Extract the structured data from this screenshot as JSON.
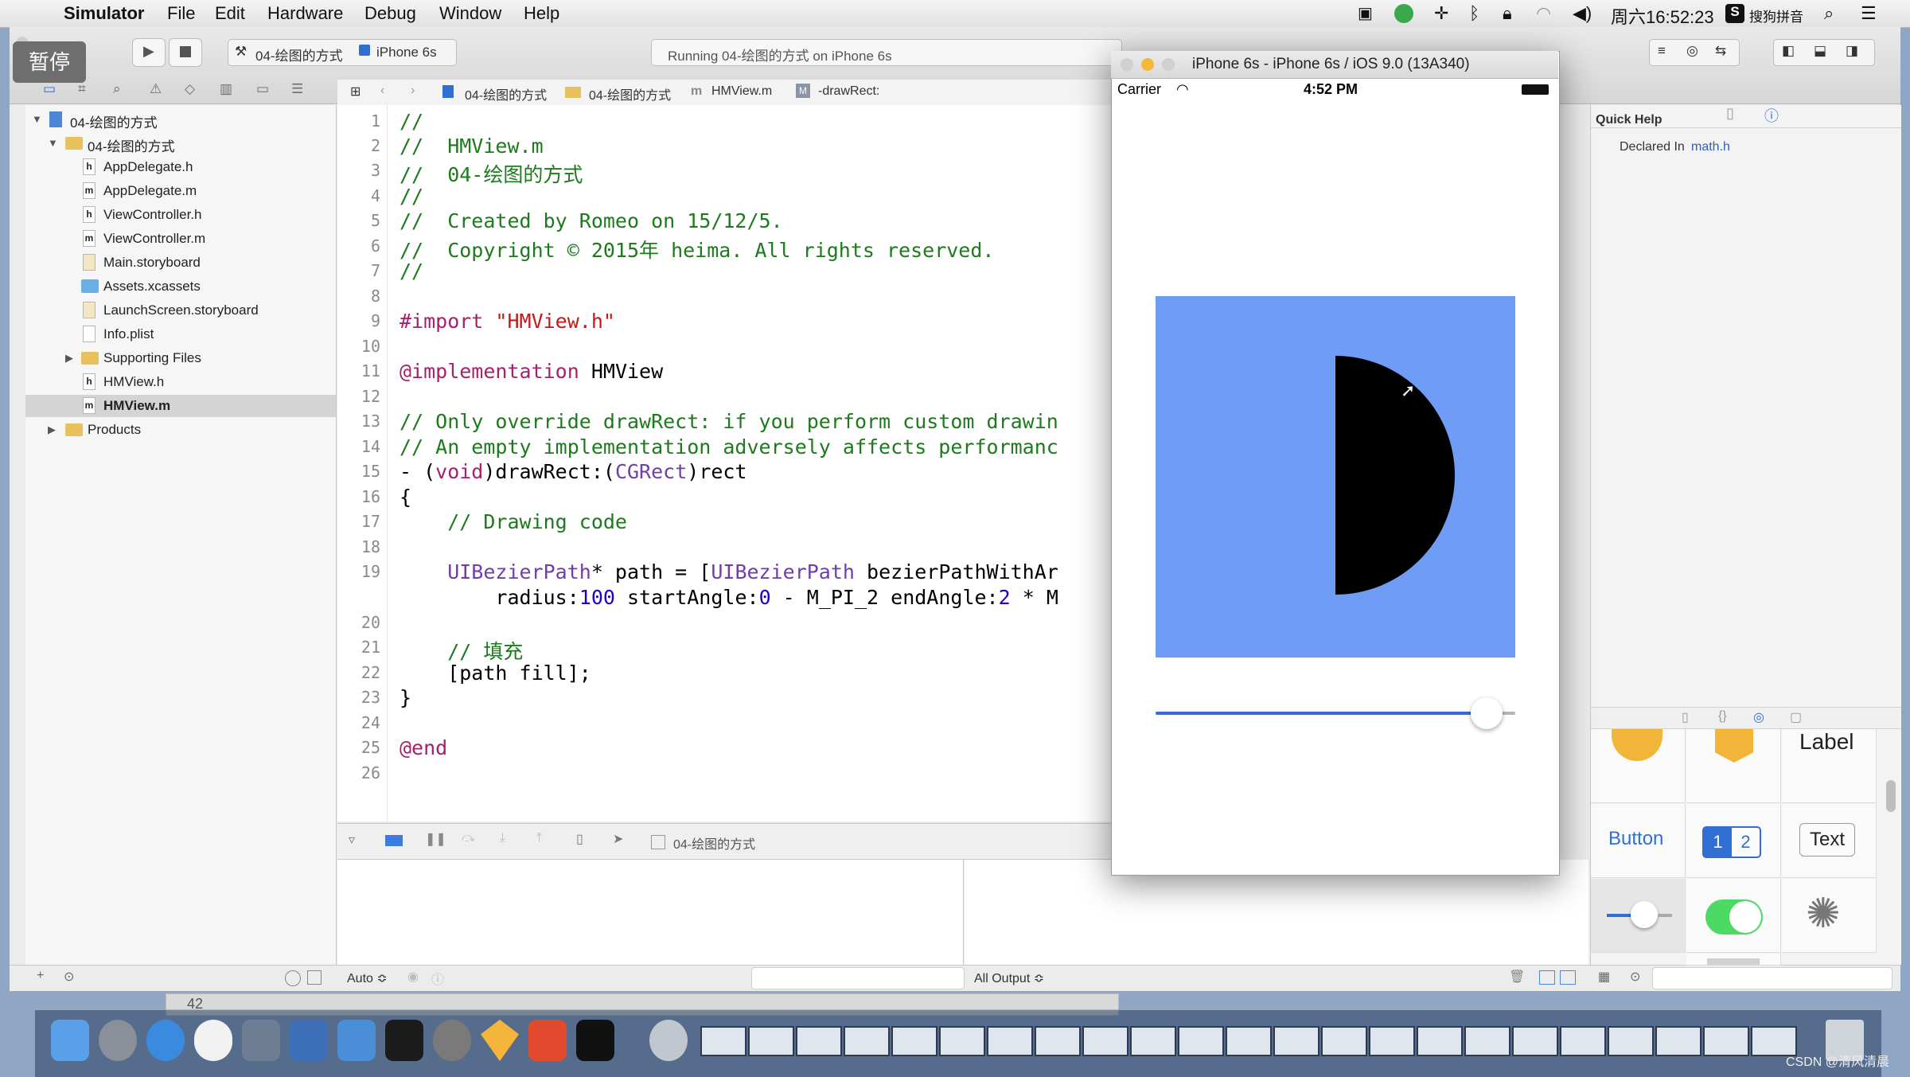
{
  "menubar": {
    "app_name": "Simulator",
    "items": [
      "File",
      "Edit",
      "Hardware",
      "Debug",
      "Window",
      "Help"
    ],
    "clock": "周六16:52:23",
    "input_method": "搜狗拼音"
  },
  "pause_badge": "暂停",
  "toolbar": {
    "scheme": "04-绘图的方式",
    "device": "iPhone 6s",
    "status": "Running 04-绘图的方式 on iPhone 6s"
  },
  "jumpbar": {
    "project": "04-绘图的方式",
    "group": "04-绘图的方式",
    "file": "HMView.m",
    "symbol": "-drawRect:"
  },
  "navigator": {
    "items": [
      {
        "label": "04-绘图的方式",
        "kind": "project"
      },
      {
        "label": "04-绘图的方式",
        "kind": "folder"
      },
      {
        "label": "AppDelegate.h",
        "kind": "h"
      },
      {
        "label": "AppDelegate.m",
        "kind": "m"
      },
      {
        "label": "ViewController.h",
        "kind": "h"
      },
      {
        "label": "ViewController.m",
        "kind": "m"
      },
      {
        "label": "Main.storyboard",
        "kind": "storyboard"
      },
      {
        "label": "Assets.xcassets",
        "kind": "assets"
      },
      {
        "label": "LaunchScreen.storyboard",
        "kind": "storyboard"
      },
      {
        "label": "Info.plist",
        "kind": "plist"
      },
      {
        "label": "Supporting Files",
        "kind": "folder"
      },
      {
        "label": "HMView.h",
        "kind": "h"
      },
      {
        "label": "HMView.m",
        "kind": "m"
      },
      {
        "label": "Products",
        "kind": "folder"
      }
    ]
  },
  "editor": {
    "line_numbers": [
      "1",
      "2",
      "3",
      "4",
      "5",
      "6",
      "7",
      "8",
      "9",
      "10",
      "11",
      "12",
      "13",
      "14",
      "15",
      "16",
      "17",
      "18",
      "19",
      "20",
      "21",
      "22",
      "23",
      "24",
      "25",
      "26"
    ],
    "lines": {
      "l1": "//",
      "l2": "//  HMView.m",
      "l3": "//  04-绘图的方式",
      "l4": "//",
      "l5": "//  Created by Romeo on 15/12/5.",
      "l6": "//  Copyright © 2015年 heima. All rights reserved.",
      "l7": "//",
      "l9_kw": "#import",
      "l9_str": "\"HMView.h\"",
      "l11_kw": "@implementation",
      "l11_rest": "HMView",
      "l13": "// Only override drawRect: if you perform custom drawin",
      "l14": "// An empty implementation adversely affects performanc",
      "l15_a": "- (",
      "l15_kw": "void",
      "l15_b": ")drawRect:(",
      "l15_tp": "CGRect",
      "l15_c": ")rect",
      "l16": "{",
      "l17": "    // Drawing code",
      "l19_tp": "    UIBezierPath",
      "l19_a": "* path = [",
      "l19_tp2": "UIBezierPath",
      "l19_b": " bezierPathWithAr",
      "l20_a": "        radius:",
      "l20_n1": "100",
      "l20_b": " startAngle:",
      "l20_n2": "0",
      "l20_c": " - M_PI_2 endAngle:",
      "l20_n3": "2",
      "l20_d": " * M",
      "l21": "    // 填充",
      "l22": "    [path fill];",
      "l23": "}",
      "l25": "@end"
    }
  },
  "debugbar": {
    "target": "04-绘图的方式"
  },
  "console": {
    "filter_left": "Auto ≎",
    "filter_right": "All Output ≎"
  },
  "bottom": {
    "line_count": "42"
  },
  "simulator": {
    "title": "iPhone 6s - iPhone 6s / iOS 9.0 (13A340)",
    "carrier": "Carrier",
    "time": "4:52 PM",
    "canvas_color": "#6f9cf5",
    "slider_value": 0.96
  },
  "utilities": {
    "quick_help_title": "Quick Help",
    "declared_in_label": "Declared In",
    "declared_in_value": "math.h",
    "library": {
      "label": "Label",
      "button": "Button",
      "seg1": "1",
      "seg2": "2",
      "text": "Text"
    }
  },
  "watermark": "CSDN @清风清晨"
}
